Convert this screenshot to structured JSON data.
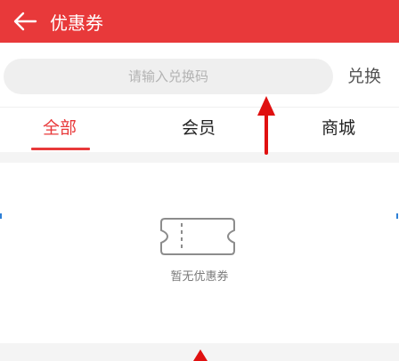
{
  "header": {
    "title": "优惠券",
    "back_icon": "arrow-left-icon"
  },
  "redeem": {
    "placeholder": "请输入兑换码",
    "button_label": "兑换"
  },
  "tabs": [
    {
      "label": "全部",
      "active": true
    },
    {
      "label": "会员",
      "active": false
    },
    {
      "label": "商城",
      "active": false
    }
  ],
  "empty_state": {
    "icon": "ticket-icon",
    "text": "暂无优惠券"
  },
  "colors": {
    "accent": "#e8393a",
    "annotation_arrow": "#e01010"
  }
}
